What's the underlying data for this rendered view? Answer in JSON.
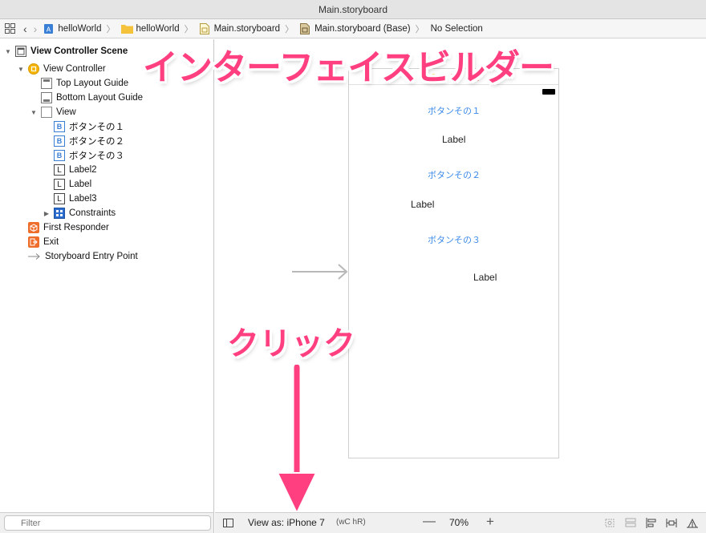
{
  "window": {
    "title": "Main.storyboard"
  },
  "jumpbar": {
    "crumbs": [
      "helloWorld",
      "helloWorld",
      "Main.storyboard",
      "Main.storyboard (Base)",
      "No Selection"
    ]
  },
  "outline": {
    "scene": "View Controller Scene",
    "view_controller": "View Controller",
    "top_guide": "Top Layout Guide",
    "bottom_guide": "Bottom Layout Guide",
    "view": "View",
    "btn1": "ボタンその１",
    "btn2": "ボタンその２",
    "btn3": "ボタンその３",
    "label2": "Label2",
    "label": "Label",
    "label3": "Label3",
    "constraints": "Constraints",
    "first_responder": "First Responder",
    "exit": "Exit",
    "entry_point": "Storyboard Entry Point",
    "icon_letter_b": "B",
    "icon_letter_l": "L"
  },
  "filter": {
    "placeholder": "Filter"
  },
  "device": {
    "btn1": "ボタンその１",
    "label_a": "Label",
    "btn2": "ボタンその２",
    "label_b": "Label",
    "btn3": "ボタンその３",
    "label_c": "Label"
  },
  "annotations": {
    "title": "インターフェイスビルダー",
    "click": "クリック"
  },
  "bottombar": {
    "view_as": "View as: iPhone 7",
    "size_class": "(wC hR)",
    "zoom_minus": "—",
    "zoom": "70%",
    "zoom_plus": "+"
  },
  "colors": {
    "accent_pink": "#ff3f7f",
    "button_blue": "#3d8be9",
    "vc_yellow": "#f5b400",
    "orange": "#ef6d2b"
  }
}
